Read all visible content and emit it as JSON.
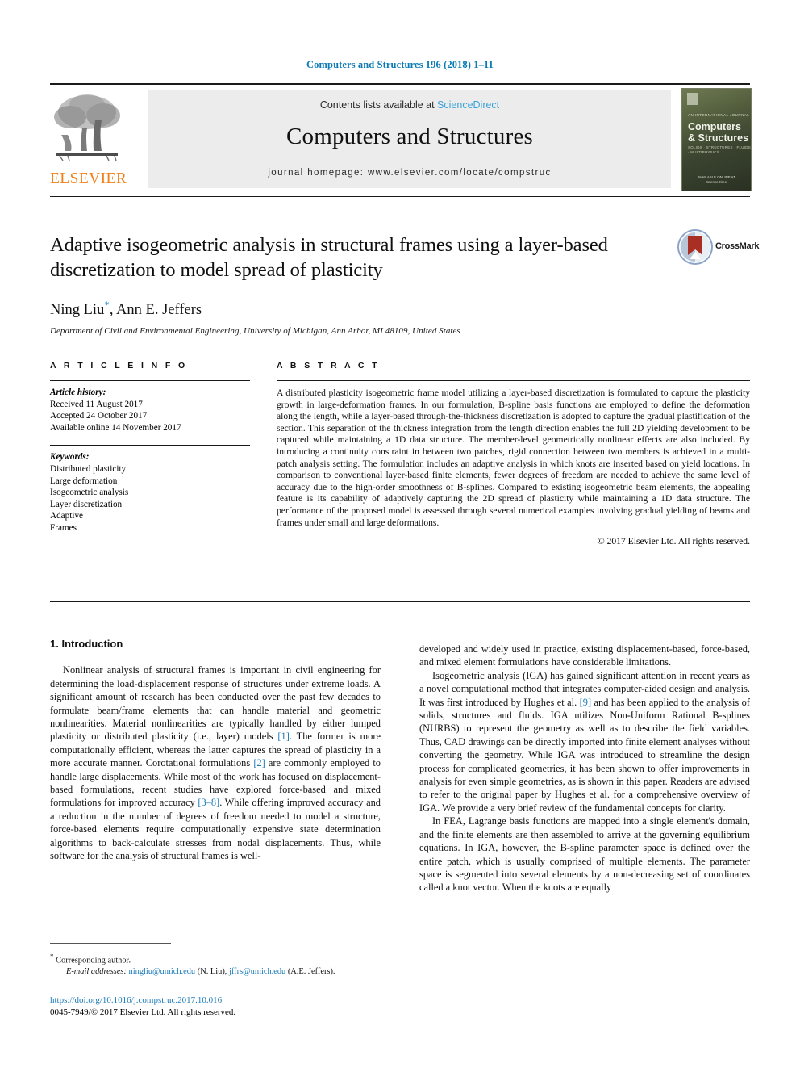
{
  "running_head": "Computers and Structures 196 (2018) 1–11",
  "masthead": {
    "publisher": "ELSEVIER",
    "contents_prefix": "Contents lists available at ",
    "contents_link": "ScienceDirect",
    "journal_name": "Computers and Structures",
    "homepage": "journal homepage: www.elsevier.com/locate/compstruc",
    "cover": {
      "kicker": "AN INTERNATIONAL JOURNAL",
      "title_line1": "Computers",
      "title_line2": "& Structures",
      "subtitle": "SOLIDS · STRUCTURES · FLUIDS · MULTIPHYSICS",
      "footer_line1": "AVAILABLE ONLINE AT",
      "footer_line2": "ScienceDirect"
    }
  },
  "article": {
    "title": "Adaptive isogeometric analysis in structural frames using a layer-based discretization to model spread of plasticity",
    "crossmark_label": "CrossMark",
    "authors": "Ning Liu",
    "corresponding_mark": "*",
    "authors_tail": ", Ann E. Jeffers",
    "affiliation": "Department of Civil and Environmental Engineering, University of Michigan, Ann Arbor, MI 48109, United States"
  },
  "info": {
    "heading": "A R T I C L E   I N F O",
    "history_label": "Article history:",
    "history": [
      "Received 11 August 2017",
      "Accepted 24 October 2017",
      "Available online 14 November 2017"
    ],
    "keywords_label": "Keywords:",
    "keywords": [
      "Distributed plasticity",
      "Large deformation",
      "Isogeometric analysis",
      "Layer discretization",
      "Adaptive",
      "Frames"
    ]
  },
  "abstract": {
    "heading": "A B S T R A C T",
    "text": "A distributed plasticity isogeometric frame model utilizing a layer-based discretization is formulated to capture the plasticity growth in large-deformation frames. In our formulation, B-spline basis functions are employed to define the deformation along the length, while a layer-based through-the-thickness discretization is adopted to capture the gradual plastification of the section. This separation of the thickness integration from the length direction enables the full 2D yielding development to be captured while maintaining a 1D data structure. The member-level geometrically nonlinear effects are also included. By introducing a continuity constraint in between two patches, rigid connection between two members is achieved in a multi-patch analysis setting. The formulation includes an adaptive analysis in which knots are inserted based on yield locations. In comparison to conventional layer-based finite elements, fewer degrees of freedom are needed to achieve the same level of accuracy due to the high-order smoothness of B-splines. Compared to existing isogeometric beam elements, the appealing feature is its capability of adaptively capturing the 2D spread of plasticity while maintaining a 1D data structure. The performance of the proposed model is assessed through several numerical examples involving gradual yielding of beams and frames under small and large deformations.",
    "copyright": "© 2017 Elsevier Ltd. All rights reserved."
  },
  "body": {
    "section_heading": "1. Introduction",
    "left_paragraphs": [
      {
        "segments": [
          {
            "text": "Nonlinear analysis of structural frames is important in civil engineering for determining the load-displacement response of structures under extreme loads. A significant amount of research has been conducted over the past few decades to formulate beam/frame elements that can handle material and geometric nonlinearities. Material nonlinearities are typically handled by either lumped plasticity or distributed plasticity (i.e., layer) models "
          },
          {
            "text": "[1]",
            "ref": true
          },
          {
            "text": ". The former is more computationally efficient, whereas the latter captures the spread of plasticity in a more accurate manner. Corotational formulations "
          },
          {
            "text": "[2]",
            "ref": true
          },
          {
            "text": " are commonly employed to handle large displacements. While most of the work has focused on displacement-based formulations, recent studies have explored force-based and mixed formulations for improved accuracy "
          },
          {
            "text": "[3–8]",
            "ref": true
          },
          {
            "text": ". While offering improved accuracy and a reduction in the number of degrees of freedom needed to model a structure, force-based elements require computationally expensive state determination algorithms to back-calculate stresses from nodal displacements. Thus, while software for the analysis of structural frames is well-"
          }
        ]
      }
    ],
    "right_paragraphs": [
      {
        "continued": true,
        "segments": [
          {
            "text": "developed and widely used in practice, existing displacement-based, force-based, and mixed element formulations have considerable limitations."
          }
        ]
      },
      {
        "segments": [
          {
            "text": "Isogeometric analysis (IGA) has gained significant attention in recent years as a novel computational method that integrates computer-aided design and analysis. It was first introduced by Hughes et al. "
          },
          {
            "text": "[9]",
            "ref": true
          },
          {
            "text": " and has been applied to the analysis of solids, structures and fluids. IGA utilizes Non-Uniform Rational B-splines (NURBS) to represent the geometry as well as to describe the field variables. Thus, CAD drawings can be directly imported into finite element analyses without converting the geometry. While IGA was introduced to streamline the design process for complicated geometries, it has been shown to offer improvements in analysis for even simple geometries, as is shown in this paper. Readers are advised to refer to the original paper by Hughes et al. for a comprehensive overview of IGA. We provide a very brief review of the fundamental concepts for clarity."
          }
        ]
      },
      {
        "segments": [
          {
            "text": "In FEA, Lagrange basis functions are mapped into a single element's domain, and the finite elements are then assembled to arrive at the governing equilibrium equations. In IGA, however, the B-spline parameter space is defined over the entire patch, which is usually comprised of multiple elements. The parameter space is segmented into several elements by a non-decreasing set of coordinates called a knot vector. When the knots are equally"
          }
        ]
      }
    ]
  },
  "footer": {
    "corresponding_star": "*",
    "corresponding_text": "Corresponding author.",
    "email_label": "E-mail addresses:",
    "email1": "ningliu@umich.edu",
    "email1_name": " (N. Liu), ",
    "email2": "jffrs@umich.edu",
    "email2_name": " (A.E. Jeffers).",
    "doi": "https://doi.org/10.1016/j.compstruc.2017.10.016",
    "issn_line": "0045-7949/© 2017 Elsevier Ltd. All rights reserved."
  },
  "colors": {
    "link": "#1a7bb9",
    "running_head": "#0b7ab5",
    "elsevier_orange": "#f08019",
    "sciencedirect": "#3aa3d8"
  }
}
